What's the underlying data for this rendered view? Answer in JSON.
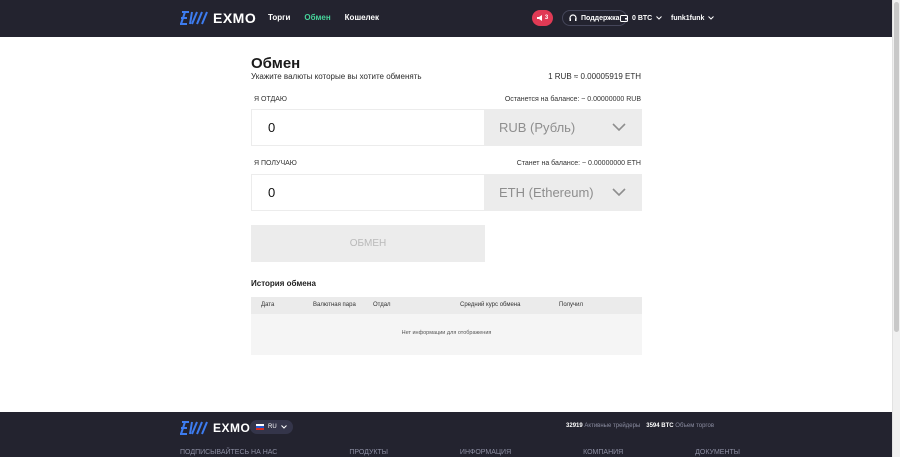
{
  "header": {
    "logo_text": "EXMO",
    "nav": [
      {
        "label": "Торги",
        "active": false
      },
      {
        "label": "Обмен",
        "active": true
      },
      {
        "label": "Кошелек",
        "active": false
      }
    ],
    "notifications_count": "3",
    "support_label": "Поддержка",
    "balance_label": "0 BTC",
    "username": "funk1funk"
  },
  "exchange": {
    "title": "Обмен",
    "subtitle": "Укажите валюты которые вы хотите обменять",
    "rate": "1 RUB ≈ 0.00005919 ETH",
    "give": {
      "label": "Я ОТДАЮ",
      "balance_note": "Останется на балансе: ~ 0.00000000 RUB",
      "amount": "0",
      "currency": "RUB (Рубль)"
    },
    "receive": {
      "label": "Я ПОЛУЧАЮ",
      "balance_note": "Станет на балансе: ~ 0.00000000 ETH",
      "amount": "0",
      "currency": "ETH (Ethereum)"
    },
    "submit_label": "ОБМЕН"
  },
  "history": {
    "title": "История обмена",
    "columns": [
      "Дата",
      "Валютная пара",
      "Отдал",
      "Средний курс обмена",
      "Получил"
    ],
    "empty_text": "Нет информации для отображения"
  },
  "footer": {
    "logo_text": "EXMO",
    "language": "RU",
    "active_traders_value": "32919",
    "active_traders_label": "Активные трейдеры",
    "volume_value": "3594 BTC",
    "volume_label": "Объем торгов",
    "links": [
      "Подписывайтесь на нас",
      "Продукты",
      "Информация",
      "Компания",
      "Документы"
    ]
  },
  "colors": {
    "header_bg": "#23232f",
    "accent_green": "#46d39a",
    "brand_blue": "#3d7cf0",
    "notification_red": "#e03a55"
  }
}
